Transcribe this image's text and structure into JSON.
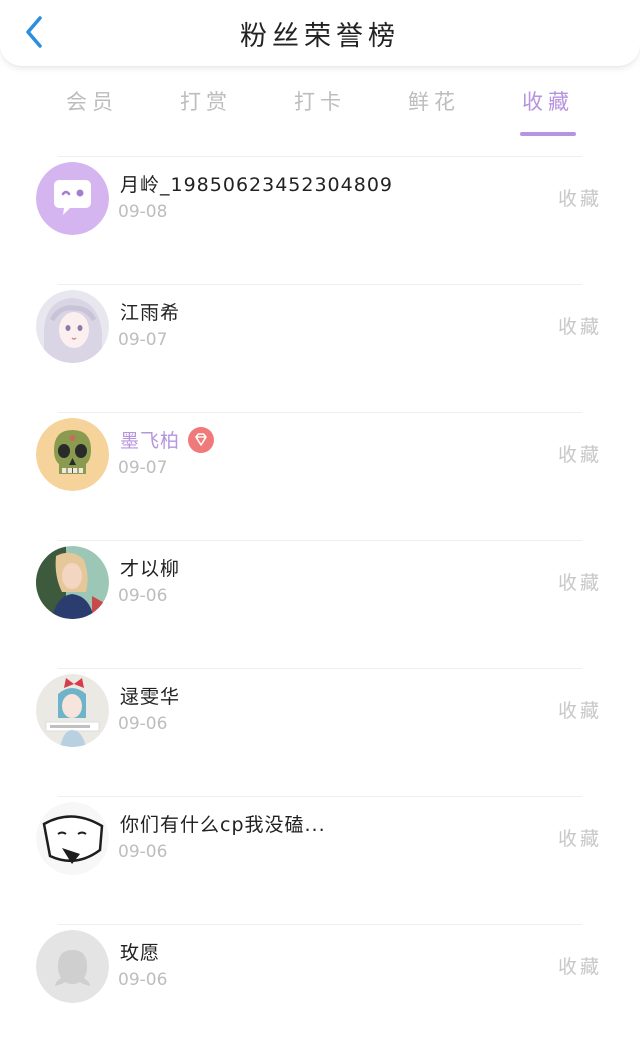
{
  "header": {
    "title": "粉丝荣誉榜"
  },
  "tabs": [
    {
      "label": "会员"
    },
    {
      "label": "打赏"
    },
    {
      "label": "打卡"
    },
    {
      "label": "鲜花"
    },
    {
      "label": "收藏",
      "active": true
    }
  ],
  "accent_color": "#b794e0",
  "list": [
    {
      "name": "月岭_19850623452304809",
      "date": "09-08",
      "action": "收藏",
      "avatar": "purple-chat-avatar"
    },
    {
      "name": "江雨希",
      "date": "09-07",
      "action": "收藏",
      "avatar": "anime-girl-avatar"
    },
    {
      "name": "墨飞柏",
      "date": "09-07",
      "action": "收藏",
      "avatar": "skull-avatar",
      "vip": true
    },
    {
      "name": "才以柳",
      "date": "09-06",
      "action": "收藏",
      "avatar": "photo-girl-avatar"
    },
    {
      "name": "逯雯华",
      "date": "09-06",
      "action": "收藏",
      "avatar": "anime-bow-avatar"
    },
    {
      "name": "你们有什么cp我没磕...",
      "date": "09-06",
      "action": "收藏",
      "avatar": "sketch-face-avatar"
    },
    {
      "name": "玫愿",
      "date": "09-06",
      "action": "收藏",
      "avatar": "default-avatar"
    }
  ]
}
